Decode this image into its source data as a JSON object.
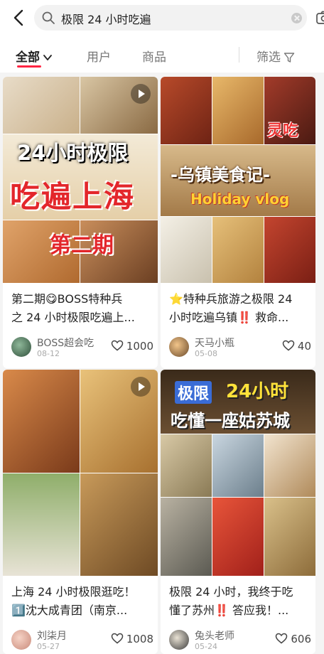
{
  "search": {
    "query": "极限 24 小时吃遍"
  },
  "tabs": {
    "all": "全部",
    "user": "用户",
    "product": "商品",
    "filter": "筛选"
  },
  "colors": {
    "accent": "#ff2442"
  },
  "icons": [
    "back-arrow-icon",
    "search-icon",
    "clear-icon",
    "camera-icon",
    "chevron-down-icon",
    "filter-icon",
    "heart-icon",
    "play-icon"
  ],
  "cards": [
    {
      "cover_text": [
        "24小时极限",
        "吃遍上海",
        "第二期"
      ],
      "title_lines": [
        "第二期😋BOSS特种兵",
        "之 24 小时极限吃遍上..."
      ],
      "author": "BOSS超会吃",
      "date": "08-12",
      "likes": "1000"
    },
    {
      "cover_text": [
        "-乌镇美食记-",
        "Holiday vlog",
        "灵吃"
      ],
      "title_lines": [
        "⭐特种兵旅游之极限 24",
        "小时吃遍乌镇‼️ 救命..."
      ],
      "author": "天马小瓶",
      "date": "05-08",
      "likes": "40"
    },
    {
      "cover_text": [],
      "title_lines": [
        "上海 24 小时极限逛吃！",
        "1️⃣沈大成青团（南京..."
      ],
      "author": "刘柒月",
      "date": "05-27",
      "likes": "1008"
    },
    {
      "cover_text": [
        "极限",
        "24小时",
        "吃懂一座姑苏城"
      ],
      "title_lines": [
        "极限 24 小时，我终于吃",
        "懂了苏州‼️ 答应我！..."
      ],
      "author": "兔头老师",
      "date": "05-24",
      "likes": "606"
    }
  ]
}
